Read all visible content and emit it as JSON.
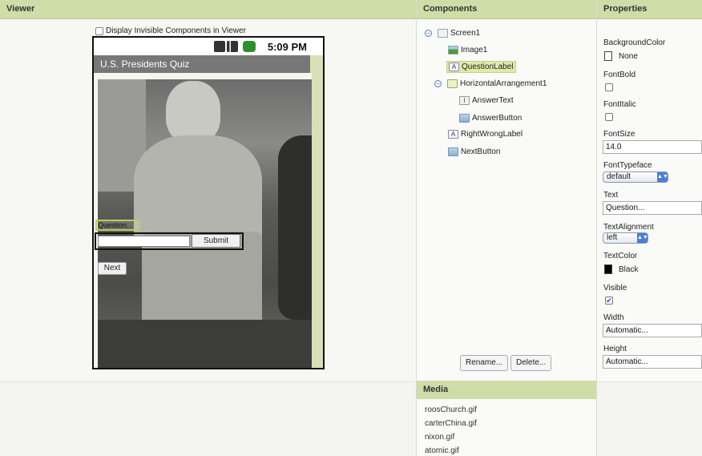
{
  "headers": {
    "viewer": "Viewer",
    "components": "Components",
    "properties": "Properties",
    "media": "Media"
  },
  "viewer": {
    "invisible_checkbox_label": "Display Invisible Components in Viewer",
    "status_time": "5:09 PM",
    "app_title": "U.S. Presidents Quiz",
    "question_label": "Question...",
    "submit_label": "Submit",
    "next_label": "Next"
  },
  "components": {
    "tree": [
      {
        "label": "Screen1",
        "icon": "screen-icon"
      },
      {
        "label": "Image1",
        "icon": "image-icon"
      },
      {
        "label": "QuestionLabel",
        "icon": "label-icon",
        "selected": true
      },
      {
        "label": "HorizontalArrangement1",
        "icon": "horizontal-arrangement-icon"
      },
      {
        "label": "AnswerText",
        "icon": "textbox-icon"
      },
      {
        "label": "AnswerButton",
        "icon": "button-icon"
      },
      {
        "label": "RightWrongLabel",
        "icon": "label-icon"
      },
      {
        "label": "NextButton",
        "icon": "button-icon"
      }
    ],
    "rename_label": "Rename...",
    "delete_label": "Delete..."
  },
  "media": {
    "files": [
      "roosChurch.gif",
      "carterChina.gif",
      "nixon.gif",
      "atomic.gif"
    ]
  },
  "properties": {
    "background_color": {
      "label": "BackgroundColor",
      "value": "None"
    },
    "font_bold": {
      "label": "FontBold",
      "checked": false
    },
    "font_italic": {
      "label": "FontItalic",
      "checked": false
    },
    "font_size": {
      "label": "FontSize",
      "value": "14.0"
    },
    "font_typeface": {
      "label": "FontTypeface",
      "value": "default"
    },
    "text": {
      "label": "Text",
      "value": "Question..."
    },
    "text_alignment": {
      "label": "TextAlignment",
      "value": "left"
    },
    "text_color": {
      "label": "TextColor",
      "value": "Black",
      "color": "#000000"
    },
    "visible": {
      "label": "Visible",
      "checked": true
    },
    "width": {
      "label": "Width",
      "value": "Automatic..."
    },
    "height": {
      "label": "Height",
      "value": "Automatic..."
    }
  },
  "colors": {
    "header_bg": "#cfdda8",
    "selection": "#dfeaa9",
    "accent": "#4a7fd4"
  }
}
